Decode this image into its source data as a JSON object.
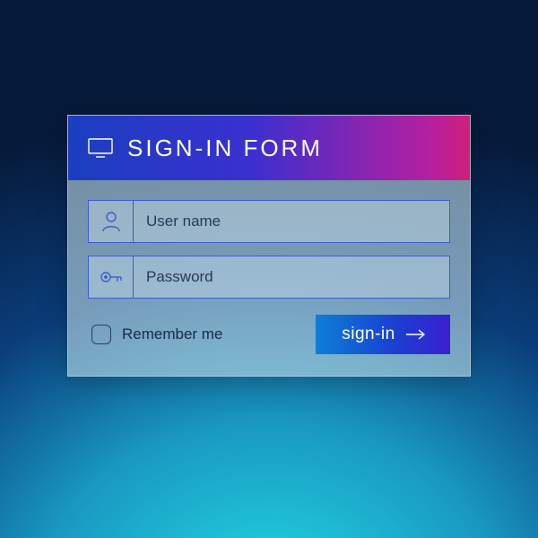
{
  "header": {
    "title": "SIGN-IN FORM"
  },
  "fields": {
    "username": {
      "placeholder": "User name",
      "value": ""
    },
    "password": {
      "placeholder": "Password",
      "value": ""
    }
  },
  "remember": {
    "label": "Remember me",
    "checked": false
  },
  "button": {
    "label": "sign-in"
  },
  "colors": {
    "accent_gradient_start": "#1a3fbf",
    "accent_gradient_end": "#d01f7a",
    "field_border": "#3b5bd0"
  }
}
